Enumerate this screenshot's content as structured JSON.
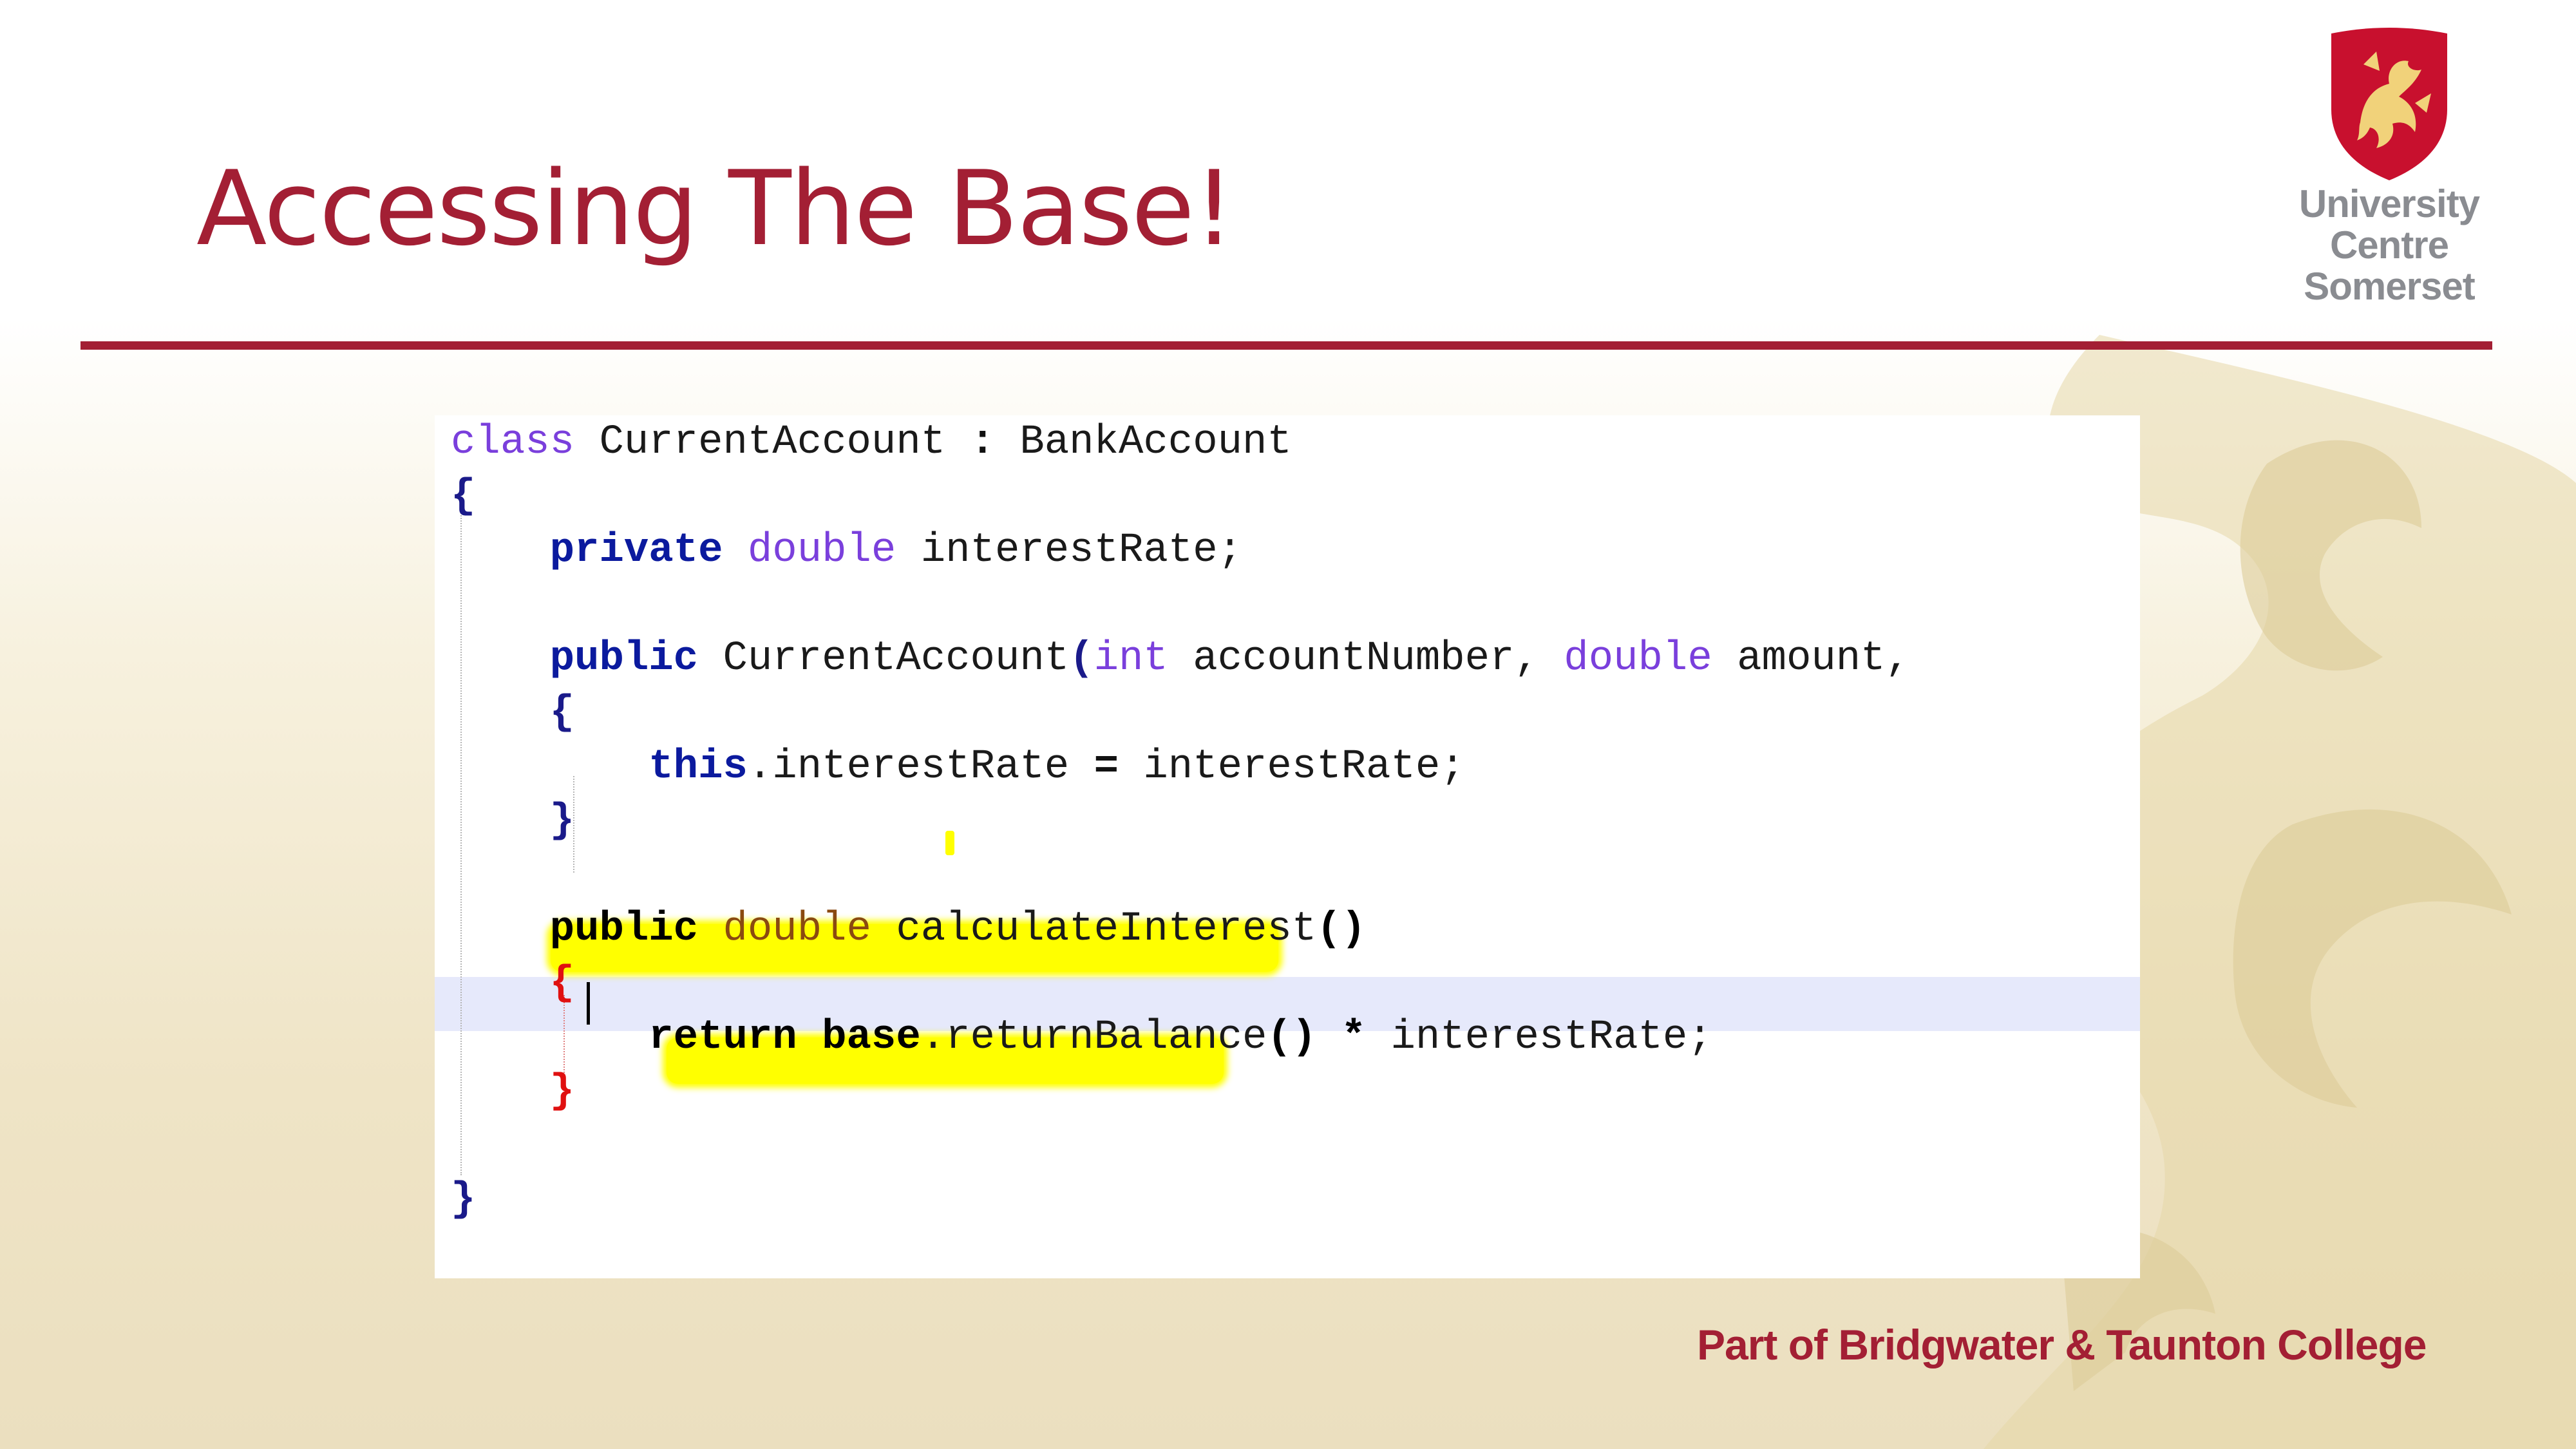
{
  "slide": {
    "title": "Accessing The Base!",
    "footer": "Part of Bridgwater & Taunton College",
    "accent_color": "#a31f34"
  },
  "logo": {
    "lines": [
      "University",
      "Centre",
      "Somerset"
    ],
    "emblem": "crest-shield-dragon",
    "shield_color": "#c8102e"
  },
  "code": {
    "line1": {
      "kw": "class",
      "name": "CurrentAccount",
      "sep": ":",
      "base": "BankAccount"
    },
    "line2": {
      "brace": "{"
    },
    "line3": {
      "kw": "private",
      "type": "double",
      "field": "interestRate;"
    },
    "line4": {
      "kw": "public",
      "ctor": "CurrentAccount",
      "paren": "(",
      "t1": "int",
      "p1": "accountNumber,",
      "t2": "double",
      "p2": "amount,"
    },
    "line5": {
      "brace": "{"
    },
    "line6": {
      "kw": "this",
      "dot": ".interestRate",
      "eq": "=",
      "rhs": "interestRate;"
    },
    "line7": {
      "brace": "}"
    },
    "line8": {
      "kw": "public",
      "type": "double",
      "method": "calculateInterest",
      "parens": "()"
    },
    "line9": {
      "brace": "{"
    },
    "line10": {
      "kw": "return",
      "base": "base",
      "call": ".returnBalance",
      "parens": "()",
      "op": "*",
      "rhs": "interestRate;"
    },
    "line11": {
      "brace": "}"
    },
    "line12": {
      "brace": "}"
    }
  },
  "highlight_color": "#ffff00"
}
